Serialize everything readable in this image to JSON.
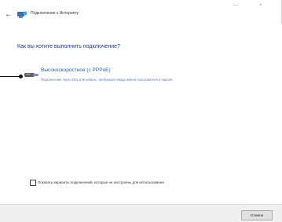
{
  "window": {
    "title": "Подключение к Интернету",
    "minimize_glyph": "—",
    "close_glyph": "×"
  },
  "page": {
    "heading": "Как вы хотите выполнить подключение?"
  },
  "options": [
    {
      "title": "Высокоскоростное (с PPPoE)",
      "description": "Подключение через DSL или кабель, требующее ввода имени пользователя и пароля.",
      "icon": "network-adapter-icon"
    }
  ],
  "show_all_option": {
    "label": "Показать варианты подключений, которые не настроены для использования",
    "checked": false
  },
  "footer": {
    "cancel_label": "Отмена"
  },
  "colors": {
    "heading": "#1a3a8c",
    "link": "#1f5fb8",
    "description": "#5b7fb8",
    "footer_bg": "#f0f0f0"
  }
}
